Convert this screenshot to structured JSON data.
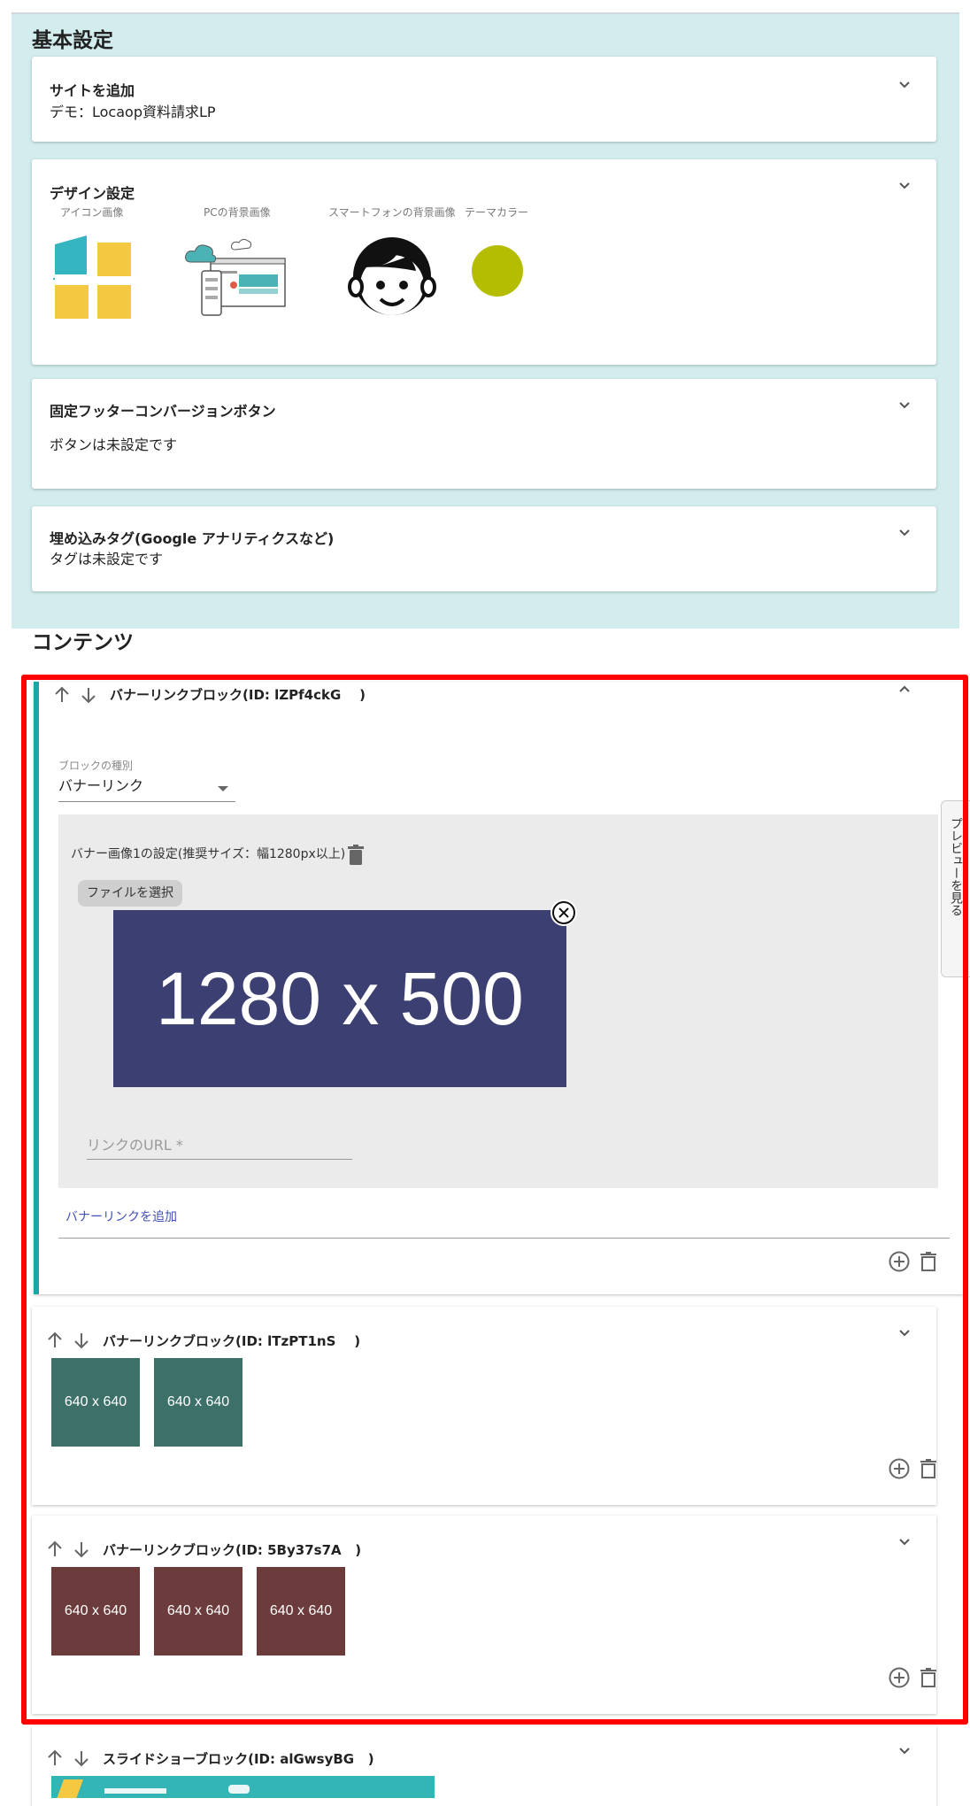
{
  "basic_settings": {
    "title": "基本設定",
    "site": {
      "title": "サイトを追加",
      "value": "デモ：Locaop資料請求LP"
    },
    "design": {
      "title": "デザイン設定",
      "icon_label": "アイコン画像",
      "pc_bg_label": "PCの背景画像",
      "sp_bg_label": "スマートフォンの背景画像",
      "theme_color_label": "テーマカラー",
      "theme_color": "#b5bd00"
    },
    "footer_button": {
      "title": "固定フッターコンバージョンボタン",
      "value": "ボタンは未設定です"
    },
    "embed_tag": {
      "title": "埋め込みタグ(Google アナリティクスなど)",
      "value": "タグは未設定です"
    }
  },
  "contents": {
    "title": "コンテンツ",
    "highlight_color": "#ff0000",
    "accent_color": "#1aa7a8",
    "block1": {
      "title_prefix": "バナーリンクブロック(ID: ",
      "id": "lZPf4ckG",
      "title_suffix": "    )",
      "block_type_label": "ブロックの種別",
      "block_type_value": "バナーリンク",
      "banner_setting_label": "バナー画像1の設定(推奨サイズ：幅1280px以上)",
      "file_button": "ファイルを選択",
      "banner_image_text": "1280 x 500",
      "banner_color": "#3c3f71",
      "url_placeholder": "リンクのURL *",
      "add_banner_link": "バナーリンクを追加"
    },
    "block2": {
      "title_prefix": "バナーリンクブロック(ID: ",
      "id": "lTzPT1nS",
      "title_suffix": "    )",
      "thumb_color": "#3c7068",
      "thumbs": [
        "640 x 640",
        "640 x 640"
      ]
    },
    "block3": {
      "title_prefix": "バナーリンクブロック(ID: ",
      "id": "5By37s7A",
      "title_suffix": "   )",
      "thumb_color": "#6c3b3b",
      "thumbs": [
        "640 x 640",
        "640 x 640",
        "640 x 640"
      ]
    },
    "block4": {
      "title_prefix": "スライドショーブロック(ID: ",
      "id": "alGwsyBG",
      "title_suffix": "   )"
    }
  },
  "preview_tab": {
    "label": "プレビューを見る"
  }
}
